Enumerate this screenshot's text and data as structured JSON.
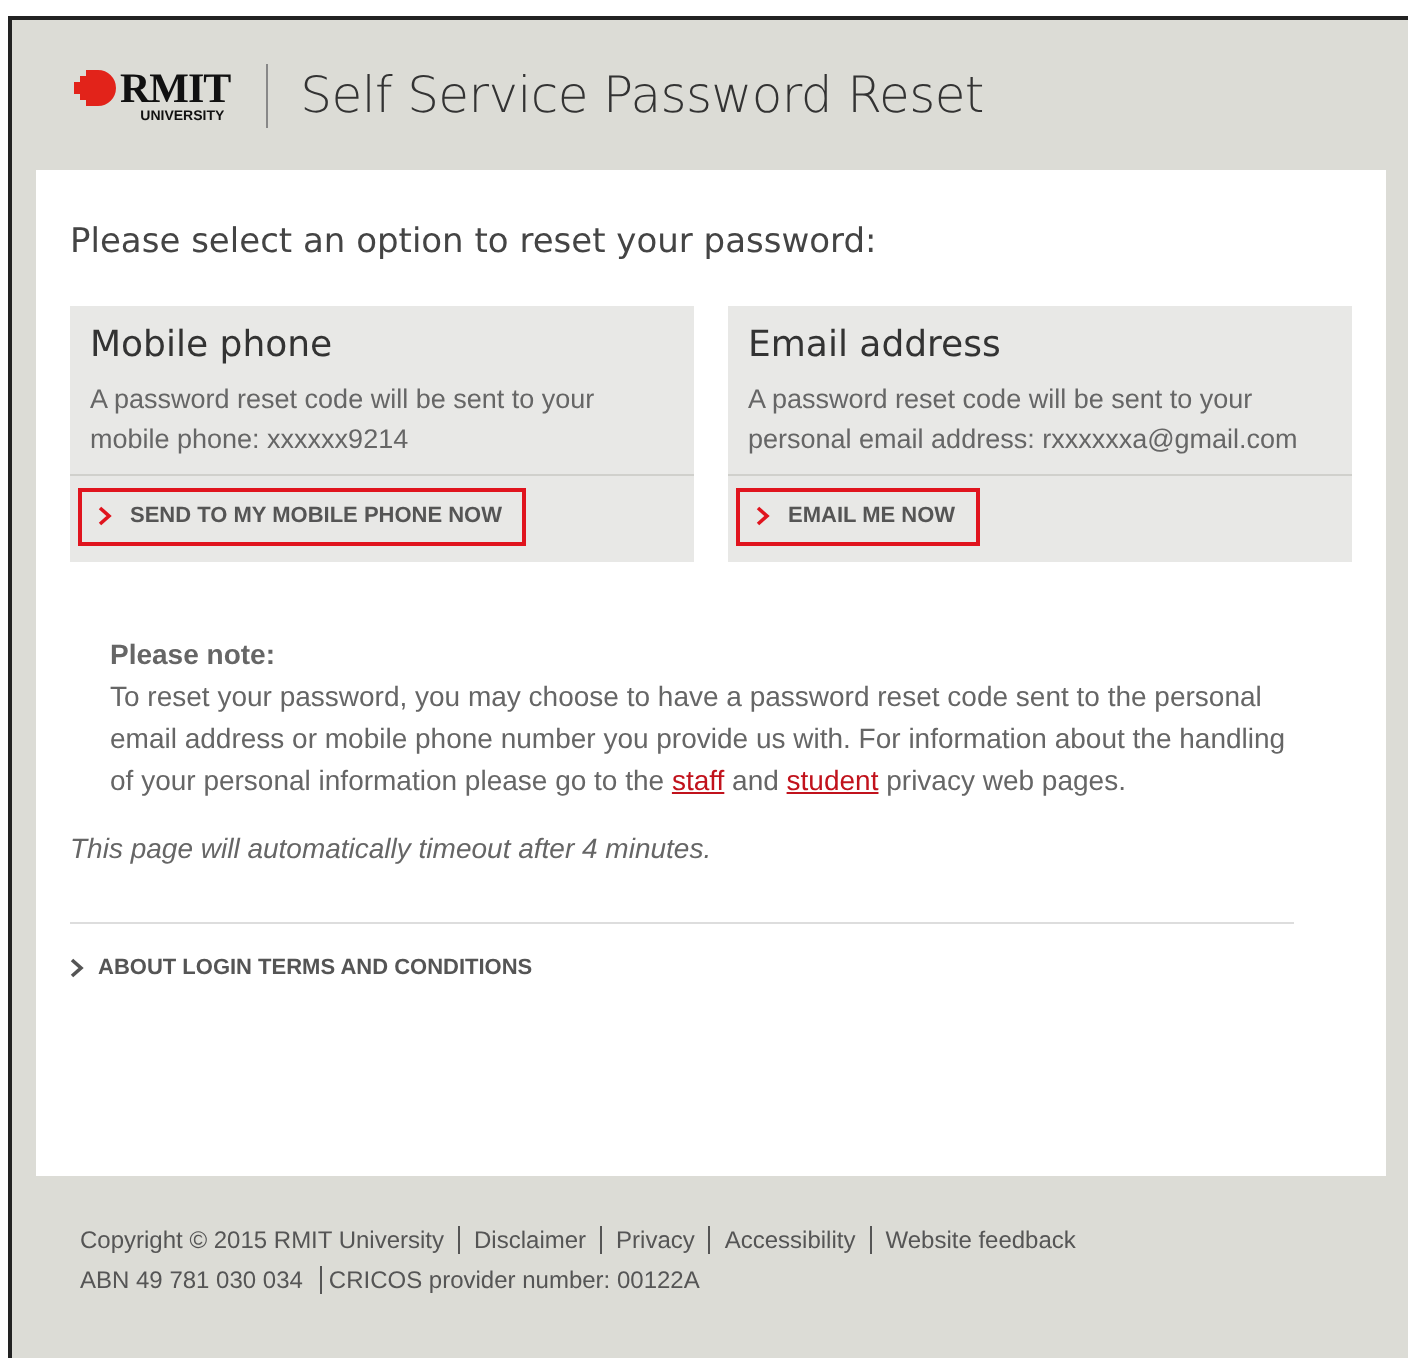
{
  "header": {
    "logo": {
      "wordmark": "RMIT",
      "subtitle": "UNIVERSITY"
    },
    "title": "Self Service Password Reset"
  },
  "prompt": "Please select an option to reset your password:",
  "options": [
    {
      "title": "Mobile phone",
      "description": "A password reset code will be sent to your mobile phone: xxxxxx9214",
      "button": "SEND TO MY MOBILE PHONE NOW",
      "highlighted": true
    },
    {
      "title": "Email address",
      "description": "A password reset code will be sent to your personal email address: rxxxxxxa@gmail.com",
      "button": "EMAIL ME NOW",
      "highlighted": true
    }
  ],
  "note": {
    "heading": "Please note:",
    "text_before": "To reset your password, you may choose to have a password reset code sent to the personal email address or mobile phone number you provide us with. For information about the handling of your personal information please go to the",
    "link_1": "staff",
    "text_middle": "and",
    "link_2": "student",
    "text_after": "privacy web pages."
  },
  "timeout": "This page will automatically timeout after 4 minutes.",
  "terms_link": "ABOUT LOGIN TERMS AND CONDITIONS",
  "footer": {
    "line_1": [
      "Copyright © 2015 RMIT University",
      "Disclaimer",
      "Privacy",
      "Accessibility",
      "Website feedback"
    ],
    "line_2": [
      "ABN 49 781 030 034",
      "CRICOS provider number: 00122A"
    ]
  }
}
